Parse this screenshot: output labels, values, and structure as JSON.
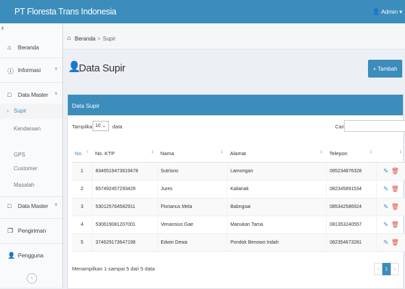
{
  "app": {
    "title": "PT Floresta Trans Indonesia"
  },
  "user_menu": {
    "label": "Admin"
  },
  "sidebar": {
    "toggle": "z",
    "items": [
      {
        "label": "Beranda",
        "icon": "home-icon"
      },
      {
        "label": "Informasi",
        "icon": "info-icon",
        "chevron": "v"
      },
      {
        "label": "Data Master",
        "icon": "folder-icon",
        "chevron": "v"
      },
      {
        "label": "Data Master",
        "icon": "folder-icon",
        "chevron": "v"
      },
      {
        "label": "Pengiriman",
        "icon": "copy-icon"
      },
      {
        "label": "Pengguna",
        "icon": "user-icon"
      }
    ],
    "sub_items": [
      "Supir",
      "Kendaraan",
      "GPS",
      "Customer",
      "Masalah"
    ],
    "collapse_glyph": "‹"
  },
  "breadcrumb": {
    "home": "Beranda",
    "separator": ">",
    "current": "Supir"
  },
  "page": {
    "title": "Data Supir",
    "add_button": "+ Tambah"
  },
  "panel": {
    "title": "Data Supir"
  },
  "table_controls": {
    "show_label": "Tampilkan",
    "page_length": "10",
    "entries_label": "data",
    "search_label": "Cari:",
    "search_value": ""
  },
  "table": {
    "columns": [
      "No.",
      "No. KTP",
      "Nama",
      "Alamat",
      "Telepon",
      ""
    ],
    "rows": [
      [
        "1",
        "8346519473819478",
        "Sutrisno",
        "Lamongan",
        "085234876328"
      ],
      [
        "2",
        "657492457293429",
        "Jures",
        "Kalianak",
        "082345891534"
      ],
      [
        "3",
        "530125764582911",
        "Florianus Mela",
        "Babngsar",
        "085342586924"
      ],
      [
        "4",
        "530619081207001",
        "Venansius Gae",
        "Manukan Tama",
        "081353240557"
      ],
      [
        "5",
        "374629173647198",
        "Edwin Dewa",
        "Pondok Benowo Indah",
        "082354673281"
      ]
    ]
  },
  "footer": {
    "info": "Menampilkan 1 sampai 5 dari 5 data",
    "pagination": {
      "prev": "‹",
      "current": "1",
      "next": "›"
    }
  },
  "colors": {
    "accent": "#3c8dbc",
    "danger": "#dd4b39",
    "sidebar_bg": "#f9fafc"
  }
}
